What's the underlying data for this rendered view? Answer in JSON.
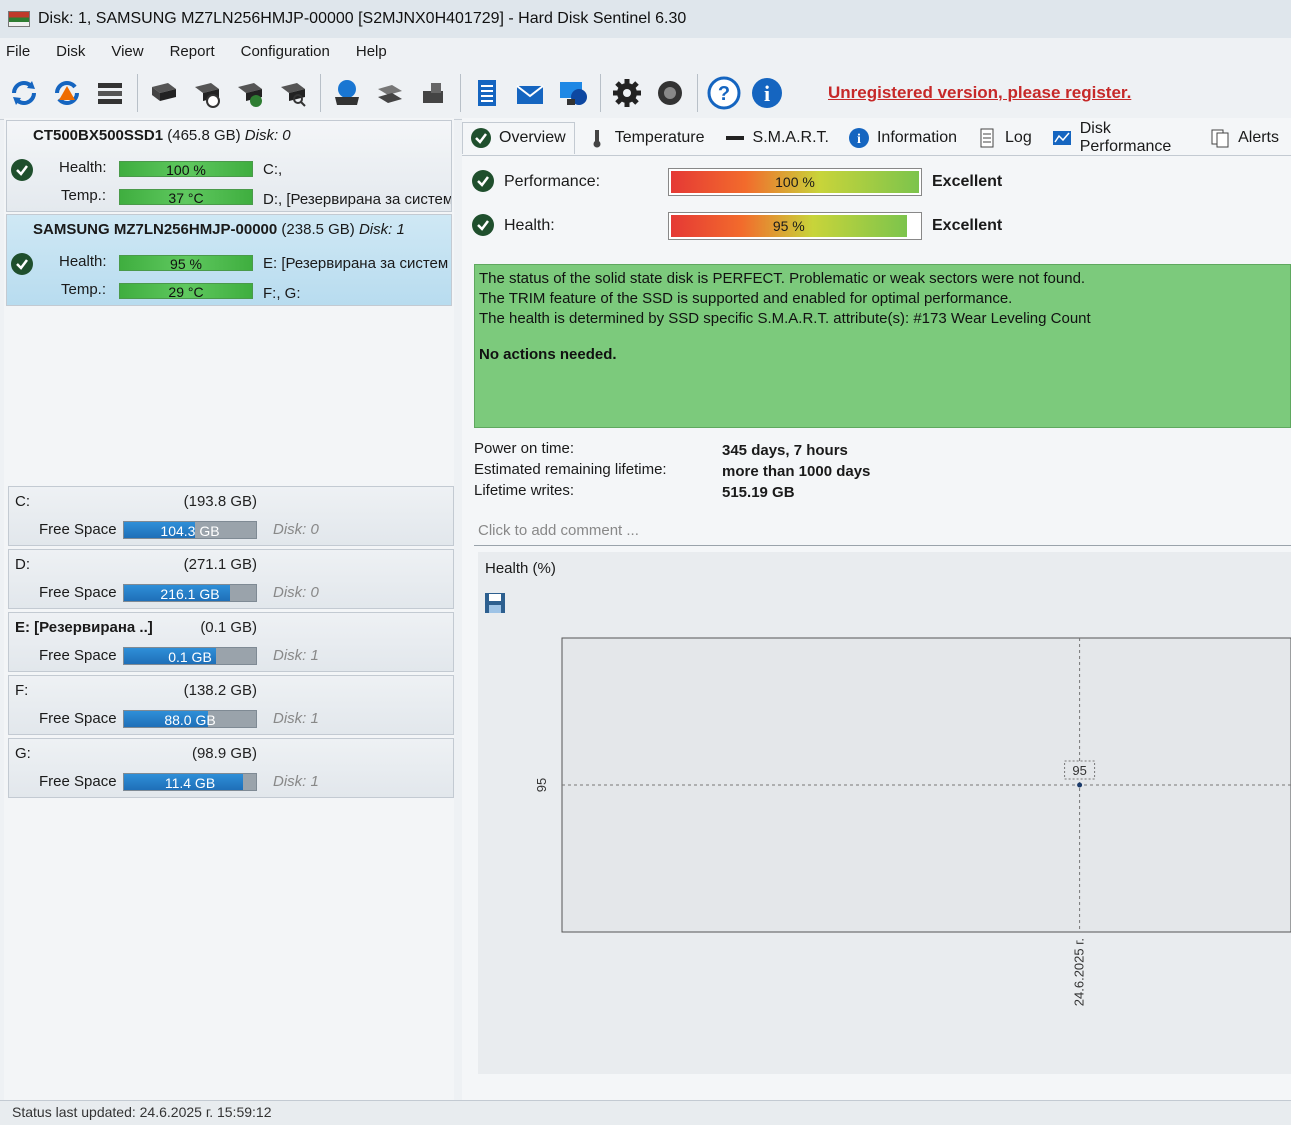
{
  "window": {
    "title": "Disk: 1, SAMSUNG MZ7LN256HMJP-00000 [S2MJNX0H401729]  -  Hard Disk Sentinel 6.30"
  },
  "menu": [
    "File",
    "Disk",
    "View",
    "Report",
    "Configuration",
    "Help"
  ],
  "toolbar": {
    "register_text": "Unregistered version, please register."
  },
  "disks": [
    {
      "model": "CT500BX500SSD1",
      "size": "(465.8 GB)",
      "disk_label": "Disk: 0",
      "health_label": "Health:",
      "health_value": "100 %",
      "temp_label": "Temp.:",
      "temp_value": "37 °C",
      "partitions_line1": "C:,",
      "partitions_line2": "D:,  [Резервирана за систем"
    },
    {
      "model": "SAMSUNG MZ7LN256HMJP-00000",
      "size": "(238.5 GB)",
      "disk_label": "Disk: 1",
      "health_label": "Health:",
      "health_value": "95 %",
      "temp_label": "Temp.:",
      "temp_value": "29 °C",
      "partitions_line1": "E: [Резервирана за систем",
      "partitions_line2": "F:, G:"
    }
  ],
  "partitions": [
    {
      "letter": "C:",
      "size": "(193.8 GB)",
      "free_label": "Free Space",
      "free": "104.3 GB",
      "free_fraction": 0.54,
      "disk": "Disk: 0"
    },
    {
      "letter": "D:",
      "size": "(271.1 GB)",
      "free_label": "Free Space",
      "free": "216.1 GB",
      "free_fraction": 0.8,
      "disk": "Disk: 0"
    },
    {
      "letter": "E: [Резервирана ..]",
      "size": "(0.1 GB)",
      "free_label": "Free Space",
      "free": "0.1 GB",
      "free_fraction": 0.7,
      "disk": "Disk: 1"
    },
    {
      "letter": "F:",
      "size": "(138.2 GB)",
      "free_label": "Free Space",
      "free": "88.0 GB",
      "free_fraction": 0.64,
      "disk": "Disk: 1"
    },
    {
      "letter": "G:",
      "size": "(98.9 GB)",
      "free_label": "Free Space",
      "free": "11.4 GB",
      "free_fraction": 0.9,
      "disk": "Disk: 1"
    }
  ],
  "tabs": [
    "Overview",
    "Temperature",
    "S.M.A.R.T.",
    "Information",
    "Log",
    "Disk Performance",
    "Alerts"
  ],
  "overview": {
    "performance_label": "Performance:",
    "performance_value": "100 %",
    "performance_fraction": 1.0,
    "performance_rating": "Excellent",
    "health_label": "Health:",
    "health_value": "95 %",
    "health_fraction": 0.95,
    "health_rating": "Excellent",
    "status_lines": [
      "The status of the solid state disk is PERFECT. Problematic or weak sectors were not found.",
      "The TRIM feature of the SSD is supported and enabled for optimal performance.",
      "The health is determined by SSD specific S.M.A.R.T. attribute(s):  #173 Wear Leveling Count"
    ],
    "status_action": "No actions needed.",
    "power_on_label": "Power on time:",
    "power_on_value": "345 days, 7 hours",
    "lifetime_label": "Estimated remaining lifetime:",
    "lifetime_value": "more than 1000 days",
    "writes_label": "Lifetime writes:",
    "writes_value": "515.19 GB",
    "comment_placeholder": "Click to add comment ...",
    "chart_title": "Health (%)"
  },
  "chart_data": {
    "type": "line",
    "title": "Health (%)",
    "x": [
      "24.6.2025 г."
    ],
    "series": [
      {
        "values": [
          95
        ]
      }
    ],
    "y_tick_labels": [
      "95"
    ],
    "x_tick_labels": [
      "24.6.2025 г."
    ],
    "data_labels": [
      "95"
    ],
    "grid": true
  },
  "statusbar": {
    "text": "Status last updated: 24.6.2025 г. 15:59:12"
  },
  "colors": {
    "ok_green": "#1f4f2d",
    "bar_green": "#3fae3f",
    "status_green": "#7cca7c",
    "free_blue": "#2f8fd8",
    "register_red": "#c62828"
  }
}
